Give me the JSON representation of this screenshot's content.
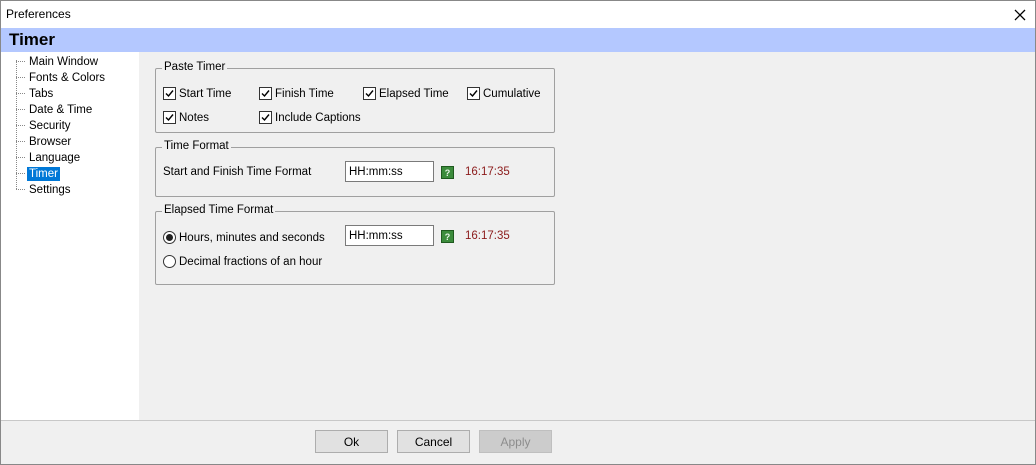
{
  "window": {
    "title": "Preferences"
  },
  "header": {
    "title": "Timer"
  },
  "tree": {
    "items": [
      {
        "label": "Main Window"
      },
      {
        "label": "Fonts & Colors"
      },
      {
        "label": "Tabs"
      },
      {
        "label": "Date & Time"
      },
      {
        "label": "Security"
      },
      {
        "label": "Browser"
      },
      {
        "label": "Language"
      },
      {
        "label": "Timer"
      },
      {
        "label": "Settings"
      }
    ],
    "selected": "Timer"
  },
  "paste_timer": {
    "legend": "Paste Timer",
    "start_time": {
      "label": "Start Time",
      "checked": true
    },
    "finish_time": {
      "label": "Finish Time",
      "checked": true
    },
    "elapsed_time": {
      "label": "Elapsed Time",
      "checked": true
    },
    "cumulative": {
      "label": "Cumulative",
      "checked": true
    },
    "notes": {
      "label": "Notes",
      "checked": true
    },
    "include_captions": {
      "label": "Include Captions",
      "checked": true
    }
  },
  "time_format": {
    "legend": "Time Format",
    "label": "Start and Finish Time Format",
    "value": "HH:mm:ss",
    "preview": "16:17:35"
  },
  "elapsed_format": {
    "legend": "Elapsed Time Format",
    "option_hms": {
      "label": "Hours, minutes and seconds",
      "selected": true
    },
    "option_decimal": {
      "label": "Decimal fractions of an hour",
      "selected": false
    },
    "value": "HH:mm:ss",
    "preview": "16:17:35"
  },
  "buttons": {
    "ok": "Ok",
    "cancel": "Cancel",
    "apply": "Apply"
  },
  "colors": {
    "header_bg": "#b4c8ff",
    "selection": "#0078d7",
    "preview_text": "#8b1a1a",
    "help_icon": "#3c8c3c"
  }
}
